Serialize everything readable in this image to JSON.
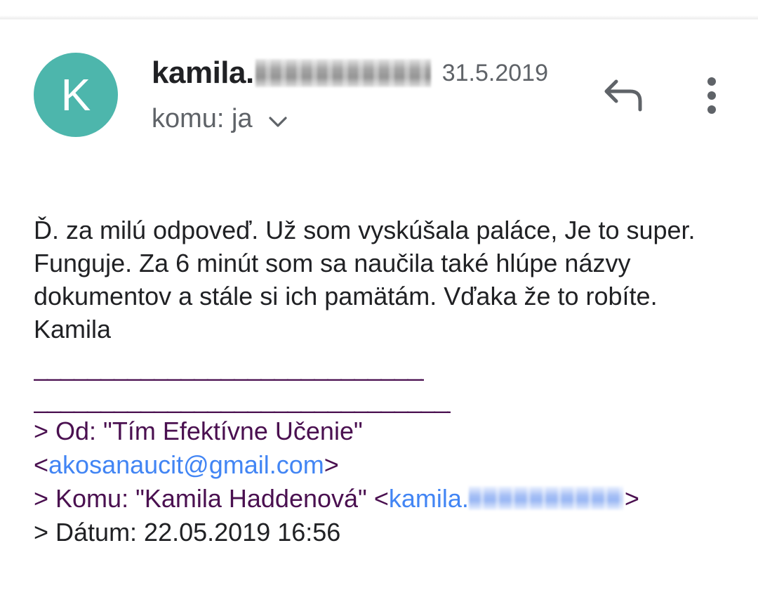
{
  "header": {
    "avatar_letter": "K",
    "avatar_color": "#4db6ac",
    "sender_name": "kamila.",
    "date": "31.5.2019",
    "recipient_label": "komu: ja"
  },
  "icons": {
    "reply": "reply-icon",
    "more": "more-vert-icon",
    "expand": "chevron-down-icon"
  },
  "message": {
    "body": "Ď. za milú odpoveď. Už som vyskúšala paláce, Je to super. Funguje. Za 6 minút som sa naučila také hlúpe názvy dokumentov a stále si ich pamätám. Vďaka že to robíte. Kamila",
    "rule1": "______________________________",
    "rule2": "________________________________",
    "quoted": {
      "from_prefix": "> Od: \"Tím Efektívne Učenie\"",
      "from_email_open": "<",
      "from_email": "akosanaucit@gmail.com",
      "from_email_close": ">",
      "to_prefix": "> Komu: \"Kamila Haddenová\" <",
      "to_email": "kamila.",
      "to_close": ">",
      "date_line": "> Dátum: 22.05.2019 16:56"
    }
  },
  "colors": {
    "quote": "#4a1050",
    "link": "#4285f4",
    "secondary_text": "#5f6368"
  }
}
